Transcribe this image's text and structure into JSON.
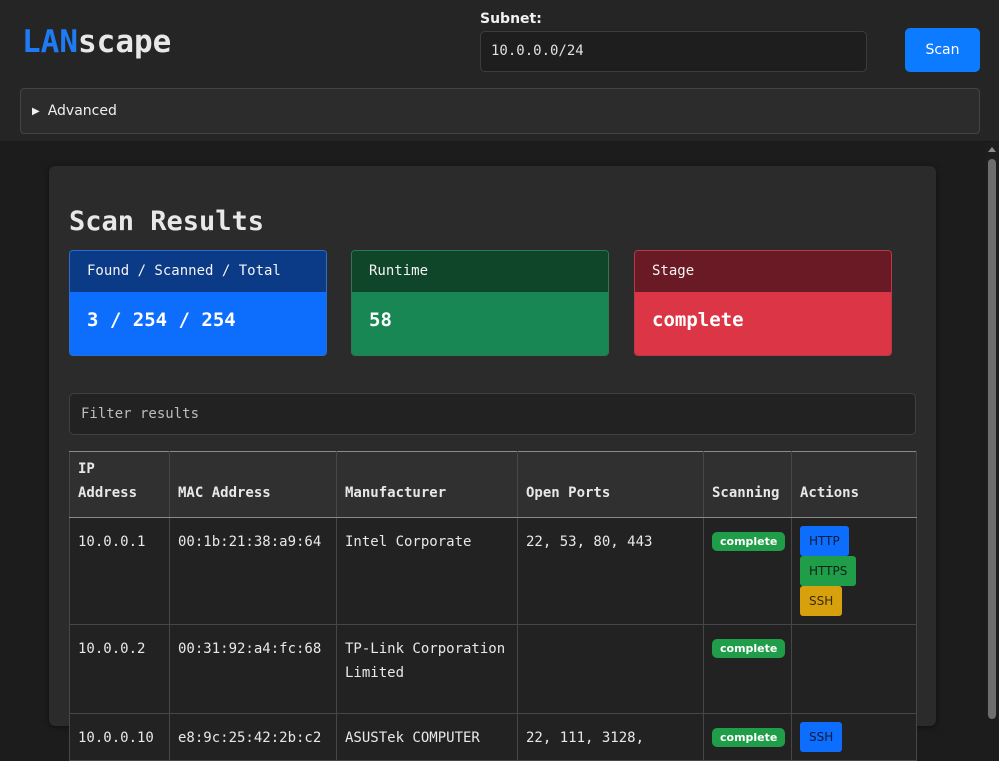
{
  "header": {
    "logo_part1": "LAN",
    "logo_part2": "scape",
    "subnet_label": "Subnet:",
    "subnet_value": "10.0.0.0/24",
    "scan_button": "Scan",
    "advanced_label": "Advanced"
  },
  "results": {
    "title": "Scan Results",
    "stats": [
      {
        "label": "Found / Scanned / Total",
        "value": "3 / 254 / 254"
      },
      {
        "label": "Runtime",
        "value": "58"
      },
      {
        "label": "Stage",
        "value": "complete"
      }
    ],
    "filter_placeholder": "Filter results",
    "columns": [
      "IP Address",
      "MAC Address",
      "Manufacturer",
      "Open Ports",
      "Scanning",
      "Actions"
    ],
    "rows": [
      {
        "ip": "10.0.0.1",
        "mac": "00:1b:21:38:a9:64",
        "manufacturer": "Intel Corporate",
        "ports": "22, 53, 80, 443",
        "status": "complete",
        "actions": [
          "HTTP",
          "HTTPS",
          "SSH"
        ]
      },
      {
        "ip": "10.0.0.2",
        "mac": "00:31:92:a4:fc:68",
        "manufacturer": "TP-Link Corporation Limited",
        "ports": "",
        "status": "complete",
        "actions": []
      },
      {
        "ip": "10.0.0.10",
        "mac": "e8:9c:25:42:2b:c2",
        "manufacturer": "ASUSTek COMPUTER",
        "ports": "22, 111, 3128,",
        "status": "complete",
        "actions": [
          "SSH"
        ]
      }
    ]
  },
  "colors": {
    "accent": "#0d6efd",
    "success": "#198754",
    "danger": "#dc3545",
    "warning": "#d6a10c"
  }
}
